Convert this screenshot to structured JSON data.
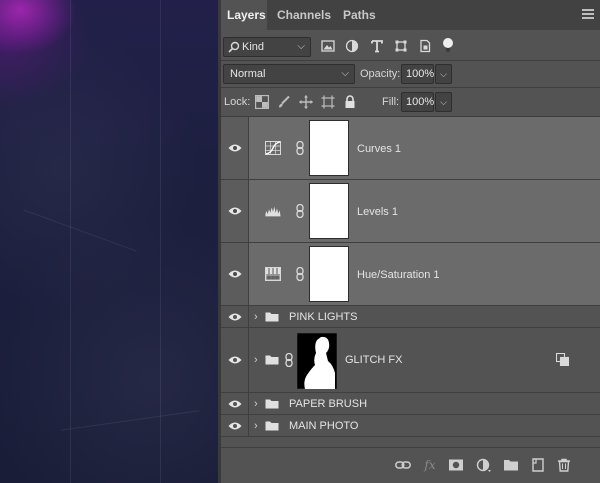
{
  "tabs": [
    {
      "label": "Layers",
      "active": true
    },
    {
      "label": "Channels",
      "active": false
    },
    {
      "label": "Paths",
      "active": false
    }
  ],
  "filter": {
    "kind_label": "Kind"
  },
  "blend": {
    "mode": "Normal",
    "opacity_label": "Opacity:",
    "opacity_value": "100%"
  },
  "lock": {
    "lock_label": "Lock:",
    "fill_label": "Fill:",
    "fill_value": "100%"
  },
  "layers": [
    {
      "name": "Curves 1",
      "type": "adjustment-curves",
      "visible": true,
      "selected": true
    },
    {
      "name": "Levels 1",
      "type": "adjustment-levels",
      "visible": true,
      "selected": true
    },
    {
      "name": "Hue/Saturation 1",
      "type": "adjustment-hue-saturation",
      "visible": true,
      "selected": true
    },
    {
      "name": "PINK LIGHTS",
      "type": "group",
      "visible": true,
      "selected": false
    },
    {
      "name": "GLITCH FX",
      "type": "group-with-mask",
      "visible": true,
      "selected": false
    },
    {
      "name": "PAPER BRUSH",
      "type": "group",
      "visible": true,
      "selected": false
    },
    {
      "name": "MAIN PHOTO",
      "type": "group",
      "visible": true,
      "selected": false
    }
  ],
  "colors": {
    "panel": "#535353",
    "selected_row": "#6b6b6b",
    "tabbar": "#424242",
    "canvas": "#1b1d33",
    "accent_glow": "#be28c8"
  },
  "bottom_icons": [
    "link-icon",
    "fx-icon",
    "add-mask-icon",
    "adjustment-icon",
    "new-group-icon",
    "new-layer-icon",
    "trash-icon"
  ]
}
